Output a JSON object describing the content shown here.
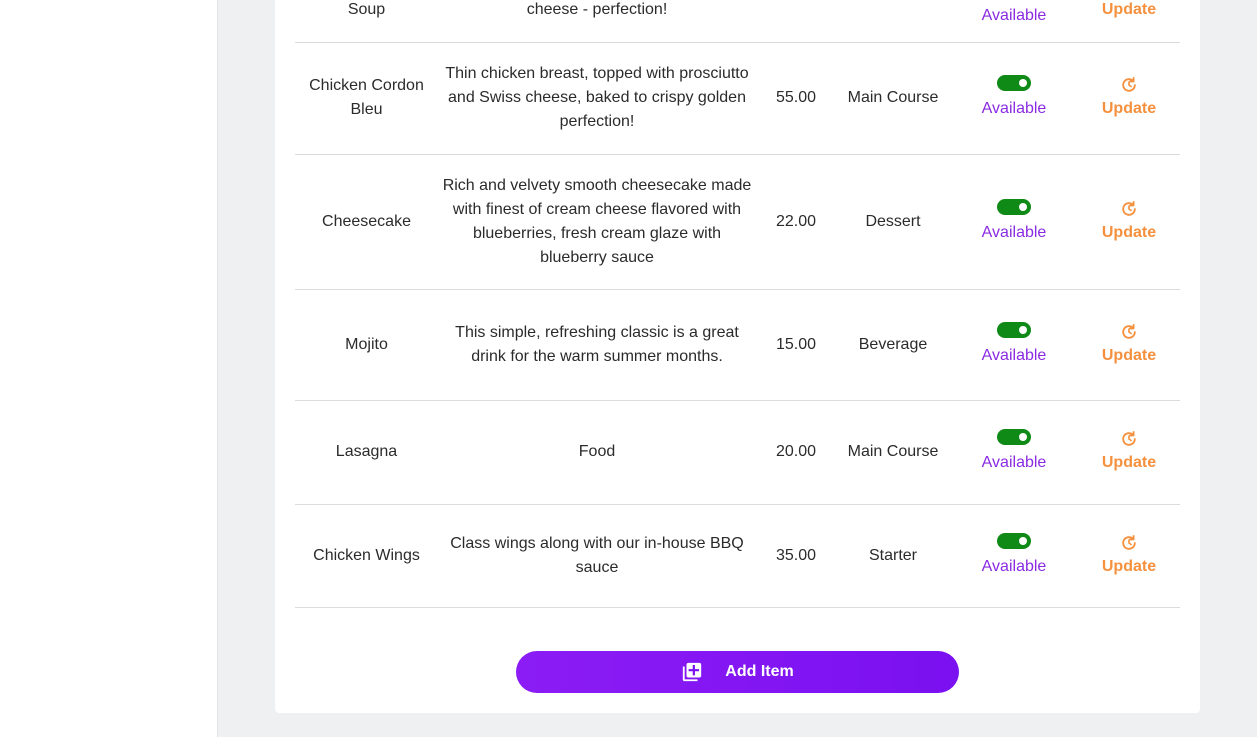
{
  "colors": {
    "accent": "#7b10f0",
    "available": "#8a2be2",
    "update": "#f5913e",
    "toggle_on": "#0f8a16"
  },
  "menu_items": [
    {
      "name": "Soup",
      "description": "cheese - perfection!",
      "price": "",
      "category": "",
      "status": "Available",
      "status_on": true,
      "action": "Update"
    },
    {
      "name": "Chicken Cordon Bleu",
      "description": "Thin chicken breast, topped with prosciutto and Swiss cheese, baked to crispy golden perfection!",
      "price": "55.00",
      "category": "Main Course",
      "status": "Available",
      "status_on": true,
      "action": "Update"
    },
    {
      "name": "Cheesecake",
      "description": "Rich and velvety smooth cheesecake made with finest of cream cheese flavored with blueberries, fresh cream glaze with blueberry sauce",
      "price": "22.00",
      "category": "Dessert",
      "status": "Available",
      "status_on": true,
      "action": "Update"
    },
    {
      "name": "Mojito",
      "description": "This simple, refreshing classic is a great drink for the warm summer months.",
      "price": "15.00",
      "category": "Beverage",
      "status": "Available",
      "status_on": true,
      "action": "Update"
    },
    {
      "name": "Lasagna",
      "description": "Food",
      "price": "20.00",
      "category": "Main Course",
      "status": "Available",
      "status_on": true,
      "action": "Update"
    },
    {
      "name": "Chicken Wings",
      "description": "Class wings along with our in-house BBQ sauce",
      "price": "35.00",
      "category": "Starter",
      "status": "Available",
      "status_on": true,
      "action": "Update"
    }
  ],
  "add_button": {
    "label": "Add Item",
    "icon": "add-library-icon"
  }
}
